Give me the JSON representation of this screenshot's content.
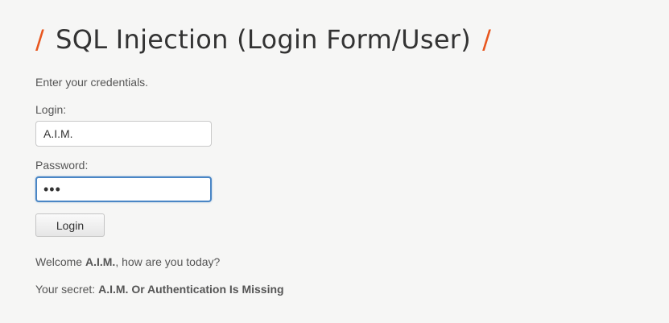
{
  "page": {
    "title": "SQL Injection (Login Form/User)",
    "title_slash": "/",
    "accent_color": "#e8561e"
  },
  "form": {
    "intro": "Enter your credentials.",
    "login_label": "Login:",
    "login_value": "A.I.M.",
    "password_label": "Password:",
    "password_value": "bug",
    "submit_label": "Login"
  },
  "result": {
    "welcome_prefix": "Welcome ",
    "welcome_user": "A.I.M.",
    "welcome_suffix": ", how are you today?",
    "secret_prefix": "Your secret: ",
    "secret_value": "A.I.M. Or Authentication Is Missing"
  }
}
